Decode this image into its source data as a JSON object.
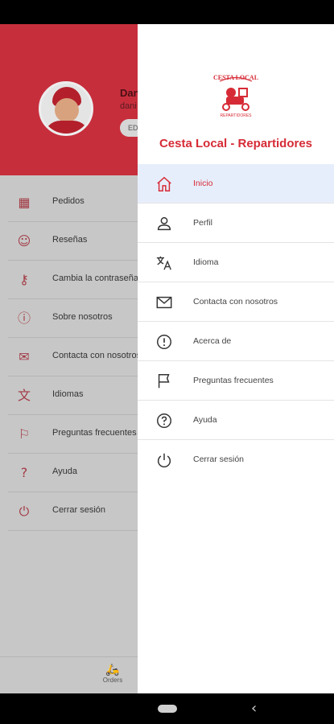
{
  "background": {
    "user_name": "Dan",
    "user_email": "dani",
    "edit_label": "ED",
    "menu": [
      {
        "label": "Pedidos",
        "icon": "calendar-icon"
      },
      {
        "label": "Reseñas",
        "icon": "review-icon"
      },
      {
        "label": "Cambia la contraseña",
        "icon": "key-icon"
      },
      {
        "label": "Sobre nosotros",
        "icon": "info-icon"
      },
      {
        "label": "Contacta con nosotros",
        "icon": "mail-icon"
      },
      {
        "label": "Idiomas",
        "icon": "translate-icon"
      },
      {
        "label": "Preguntas frecuentes",
        "icon": "flag-icon"
      },
      {
        "label": "Ayuda",
        "icon": "help-icon"
      },
      {
        "label": "Cerrar sesión",
        "icon": "power-icon"
      }
    ],
    "bottom_tab": {
      "label": "Orders",
      "icon": "orders-icon"
    }
  },
  "drawer": {
    "logo_text_top": "CESTA LOCAL",
    "logo_text_bottom": "REPARTIDORES",
    "title": "Cesta Local - Repartidores",
    "items": [
      {
        "label": "Inicio",
        "icon": "home-icon",
        "active": true
      },
      {
        "label": "Perfil",
        "icon": "person-icon"
      },
      {
        "label": "Idioma",
        "icon": "translate-icon"
      },
      {
        "label": "Contacta con nosotros",
        "icon": "mail-icon"
      },
      {
        "label": "Acerca de",
        "icon": "info-icon"
      },
      {
        "label": "Preguntas frecuentes",
        "icon": "flag-icon"
      },
      {
        "label": "Ayuda",
        "icon": "help-icon"
      },
      {
        "label": "Cerrar sesión",
        "icon": "power-icon"
      }
    ]
  },
  "colors": {
    "brand_red": "#d62b36",
    "header_red": "#c72e3c",
    "active_bg": "#e7eefb"
  }
}
